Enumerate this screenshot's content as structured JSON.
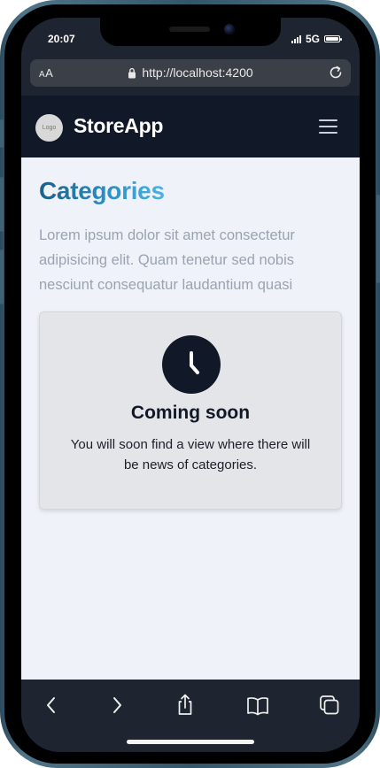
{
  "status_bar": {
    "time": "20:07",
    "network": "5G",
    "icons": [
      "signal-icon",
      "battery-icon"
    ]
  },
  "browser": {
    "text_size_button": "AA",
    "url": "http://localhost:4200",
    "icons": {
      "lock": "lock-icon",
      "reload": "reload-icon"
    },
    "toolbar": [
      {
        "name": "back-button",
        "icon": "chevron-left-icon"
      },
      {
        "name": "forward-button",
        "icon": "chevron-right-icon"
      },
      {
        "name": "share-button",
        "icon": "share-icon"
      },
      {
        "name": "bookmarks-button",
        "icon": "book-icon"
      },
      {
        "name": "tabs-button",
        "icon": "tabs-icon"
      }
    ]
  },
  "navbar": {
    "logo_text": "Logo",
    "brand": "StoreApp",
    "menu_icon": "hamburger-menu-icon"
  },
  "page": {
    "title": "Categories",
    "description": "Lorem ipsum dolor sit amet consectetur adipisicing elit. Quam tenetur sed nobis nesciunt consequatur laudantium quasi",
    "card": {
      "icon": "clock-icon",
      "title": "Coming soon",
      "text": "You will soon find a view where there will be news of categories."
    }
  },
  "colors": {
    "navbar_bg": "#111827",
    "page_bg": "#eff2f8",
    "title_gradient_start": "#1e5f86",
    "title_gradient_end": "#4bb3e6",
    "muted_text": "#9ba3b1",
    "card_bg": "#e4e5e9"
  }
}
